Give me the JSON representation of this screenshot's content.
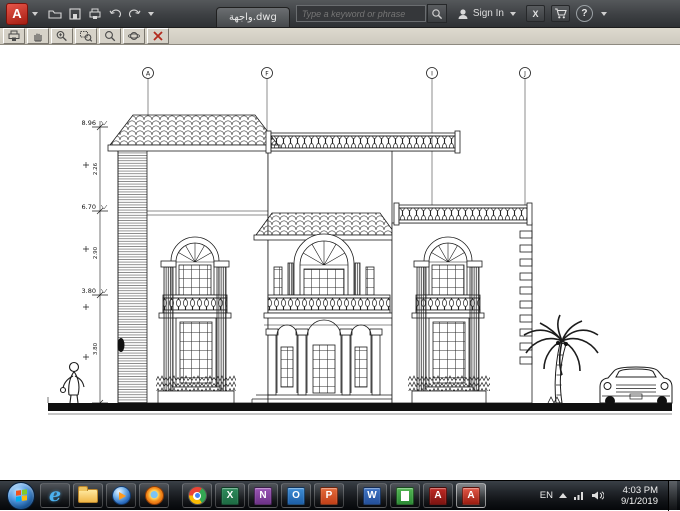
{
  "titlebar": {
    "logo_letter": "A",
    "file_tab_label": "واجهة.dwg",
    "search_placeholder": "Type a keyword or phrase",
    "sign_in_label": "Sign In",
    "exchange_glyph": "X",
    "help_glyph": "?"
  },
  "drawing": {
    "grid_bubbles": [
      "A",
      "F",
      "I",
      "J"
    ],
    "levels": [
      "8.96",
      "6.70",
      "3.80"
    ],
    "segment_dims": [
      "2.26",
      "2.90",
      "3.80"
    ]
  },
  "taskbar": {
    "language": "EN",
    "time": "4:03 PM",
    "date": "9/1/2019",
    "icons": {
      "ie": "e",
      "excel": "X",
      "onenote": "N",
      "outlook": "O",
      "powerpoint": "P",
      "word": "W",
      "adobe": "A",
      "autocad": "A"
    }
  },
  "colors": {
    "autocad_red": "#c0392b",
    "titlebar_gray": "#47494c",
    "taskbar_black": "#121417",
    "drawing_line": "#1c1c1c",
    "canvas": "#ffffff"
  }
}
